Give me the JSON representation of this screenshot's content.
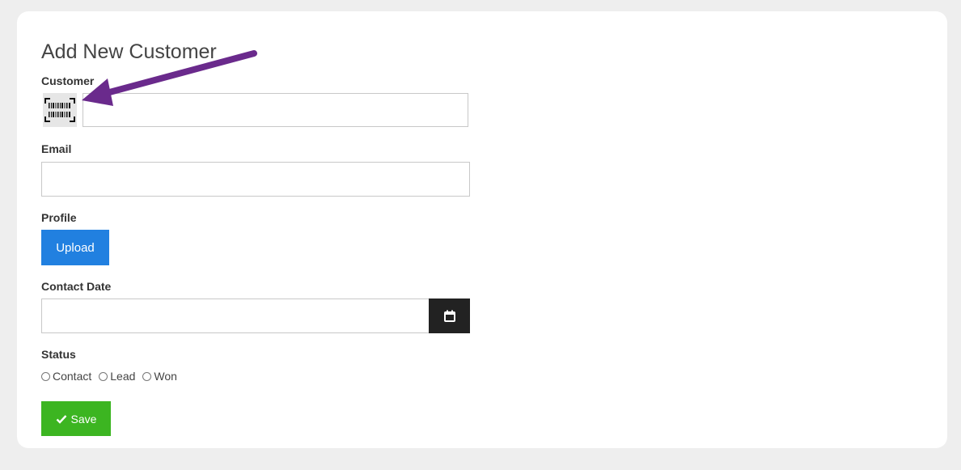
{
  "form": {
    "title": "Add New Customer",
    "customer_label": "Customer",
    "customer_value": "",
    "email_label": "Email",
    "email_value": "",
    "profile_label": "Profile",
    "upload_label": "Upload",
    "contact_date_label": "Contact Date",
    "contact_date_value": "",
    "status_label": "Status",
    "status_options": [
      "Contact",
      "Lead",
      "Won"
    ],
    "save_label": "Save"
  },
  "icons": {
    "barcode": "barcode-scan-icon",
    "calendar": "calendar-icon",
    "save": "checkmark-icon",
    "annotation": "arrow-annotation"
  },
  "colors": {
    "upload_button": "#2180e0",
    "save_button": "#3cb521",
    "calendar_button": "#222222",
    "annotation_arrow": "#6a2a8c"
  }
}
